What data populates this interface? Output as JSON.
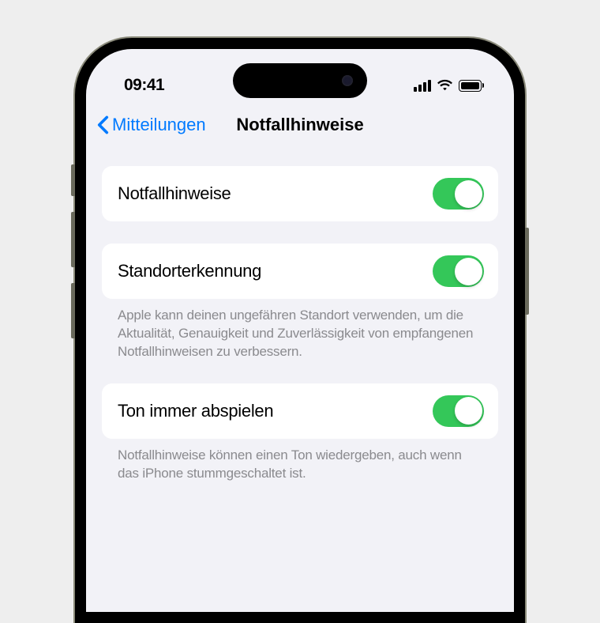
{
  "status": {
    "time": "09:41"
  },
  "nav": {
    "back_label": "Mitteilungen",
    "title": "Notfallhinweise"
  },
  "settings": {
    "emergency_alerts": {
      "label": "Notfallhinweise",
      "enabled": true
    },
    "location_detection": {
      "label": "Standorterkennung",
      "enabled": true,
      "footer": "Apple kann deinen ungefähren Standort verwenden, um die Aktualität, Genauigkeit und Zuverlässigkeit von empfangenen Notfallhinweisen zu verbessern."
    },
    "always_play_sound": {
      "label": "Ton immer abspielen",
      "enabled": true,
      "footer": "Notfallhinweise können einen Ton wiedergeben, auch wenn das iPhone stummgeschaltet ist."
    }
  },
  "colors": {
    "toggle_on": "#34c759",
    "accent": "#007aff",
    "background": "#f2f2f7"
  }
}
